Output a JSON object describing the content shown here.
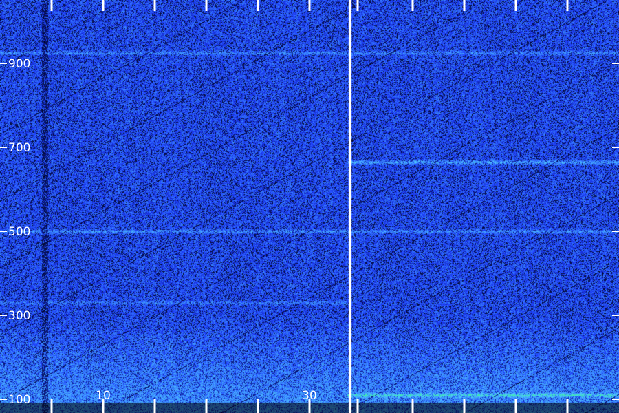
{
  "chart_data": {
    "type": "heatmap",
    "title": "",
    "xlabel": "",
    "ylabel": "",
    "ylim": [
      100,
      1000
    ],
    "yticks": [
      100,
      300,
      500,
      700,
      900
    ],
    "y_tick_labels": [
      "100",
      "300",
      "500",
      "700",
      "900"
    ],
    "x_tick_labels": [
      "10",
      "30"
    ],
    "panels": 2,
    "colormap": [
      "#000010",
      "#0a1a8c",
      "#1e3cff",
      "#3c8cff",
      "#50c8ff",
      "#3cf0a0"
    ],
    "grid": false,
    "legend": "none",
    "features": [
      {
        "panel": 1,
        "type": "horizontal-band",
        "y": 925,
        "intensity": 0.55
      },
      {
        "panel": 1,
        "type": "horizontal-band",
        "y": 500,
        "intensity": 0.6
      },
      {
        "panel": 1,
        "type": "horizontal-band",
        "y": 330,
        "intensity": 0.4
      },
      {
        "panel": 2,
        "type": "horizontal-band",
        "y": 925,
        "intensity": 0.5
      },
      {
        "panel": 2,
        "type": "horizontal-band",
        "y": 500,
        "intensity": 0.6
      },
      {
        "panel": 2,
        "type": "horizontal-band",
        "y": 665,
        "intensity": 0.9
      },
      {
        "panel": 2,
        "type": "horizontal-band",
        "y": 110,
        "intensity": 1.0
      }
    ]
  }
}
